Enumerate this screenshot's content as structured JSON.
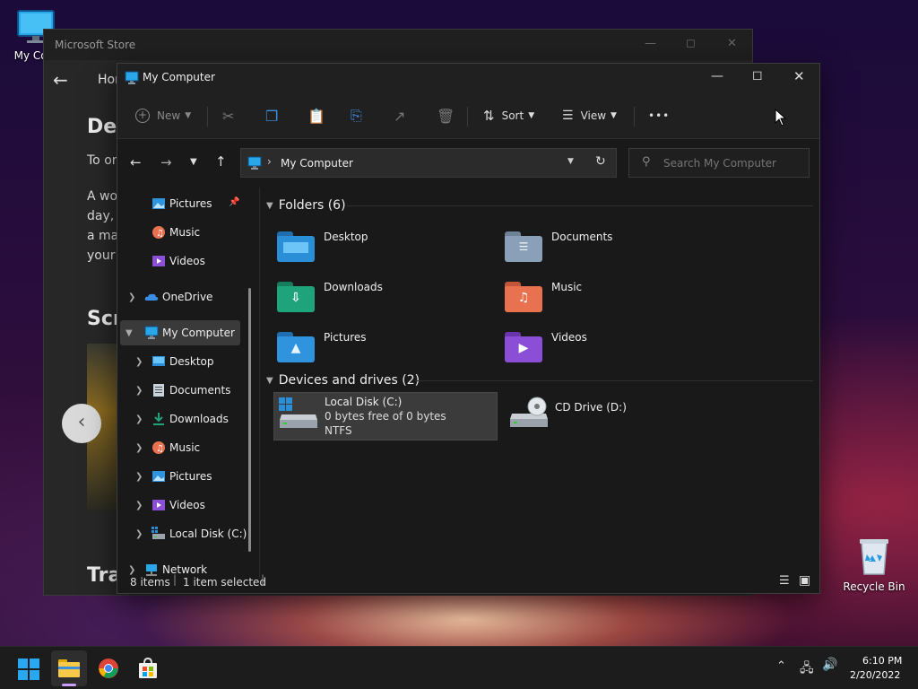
{
  "desktop": {
    "icons": [
      {
        "label": "My Com",
        "icon": "monitor-icon"
      },
      {
        "label": "Recycle Bin",
        "icon": "recycle-bin-icon"
      }
    ]
  },
  "store": {
    "title": "Microsoft Store",
    "tab_home": "Hor",
    "heading_1": "Des",
    "text_1": "To or",
    "text_2": "A wo",
    "text_3": "day, r",
    "text_4": "a mas",
    "text_5": "your",
    "heading_2": "Scr",
    "heading_3": "Tra"
  },
  "explorer": {
    "title": "My Computer",
    "toolbar": {
      "new_label": "New",
      "sort_label": "Sort",
      "view_label": "View",
      "more_label": "•••"
    },
    "address": {
      "path": "My Computer",
      "search_placeholder": "Search My Computer"
    },
    "nav": [
      {
        "label": "Pictures",
        "icon": "pictures-icon",
        "pinned": true
      },
      {
        "label": "Music",
        "icon": "music-icon"
      },
      {
        "label": "Videos",
        "icon": "videos-icon"
      },
      {
        "label": "OneDrive",
        "icon": "onedrive-icon"
      },
      {
        "label": "My Computer",
        "icon": "monitor-icon",
        "selected": true
      },
      {
        "label": "Desktop",
        "icon": "desktop-icon"
      },
      {
        "label": "Documents",
        "icon": "documents-icon"
      },
      {
        "label": "Downloads",
        "icon": "downloads-icon"
      },
      {
        "label": "Music",
        "icon": "music-icon"
      },
      {
        "label": "Pictures",
        "icon": "pictures-icon"
      },
      {
        "label": "Videos",
        "icon": "videos-icon"
      },
      {
        "label": "Local Disk (C:)",
        "icon": "disk-icon"
      },
      {
        "label": "Network",
        "icon": "network-icon"
      }
    ],
    "folders_header": "Folders (6)",
    "folders": [
      {
        "label": "Desktop",
        "color": "#2b8fd8"
      },
      {
        "label": "Documents",
        "color": "#8aa0b8"
      },
      {
        "label": "Downloads",
        "color": "#1fa37a"
      },
      {
        "label": "Music",
        "color": "#e8714f"
      },
      {
        "label": "Pictures",
        "color": "#2f93de"
      },
      {
        "label": "Videos",
        "color": "#8a4fd6"
      }
    ],
    "drives_header": "Devices and drives (2)",
    "drives": [
      {
        "label": "Local Disk (C:)",
        "free": "0 bytes free of 0 bytes",
        "fs": "NTFS"
      },
      {
        "label": "CD Drive (D:)"
      }
    ],
    "status": {
      "items": "8 items",
      "selected": "1 item selected"
    }
  },
  "taskbar": {
    "time": "6:10 PM",
    "date": "2/20/2022"
  }
}
